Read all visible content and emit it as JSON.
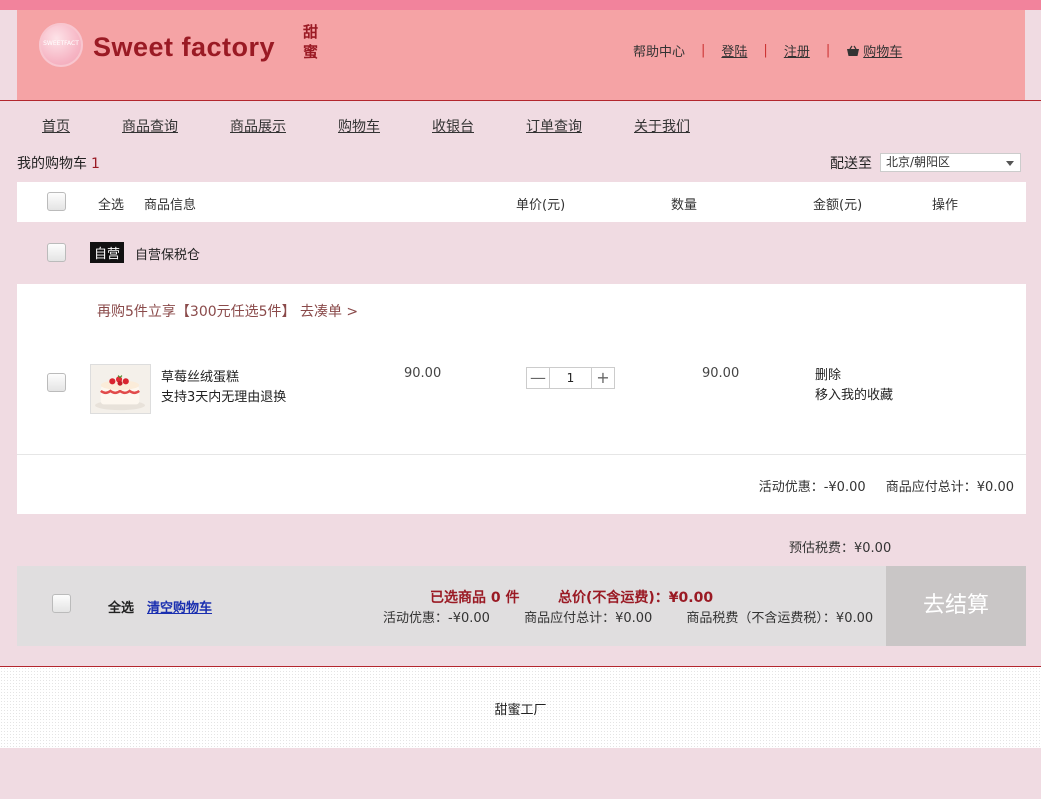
{
  "brand": {
    "name": "Sweet factory",
    "name_cn": "甜蜜",
    "logo_mark": "SWEETFACT"
  },
  "toplinks": {
    "help": "帮助中心",
    "login": "登陆",
    "register": "注册",
    "cart": "购物车",
    "separator": "|"
  },
  "nav": [
    "首页",
    "商品查询",
    "商品展示",
    "购物车",
    "收银台",
    "订单查询",
    "关于我们"
  ],
  "cart": {
    "title": "我的购物车",
    "count": "1"
  },
  "shipping": {
    "label": "配送至",
    "region": "北京/朝阳区"
  },
  "table_headers": {
    "select_all": "全选",
    "product": "商品信息",
    "unit_price": "单价(元)",
    "quantity": "数量",
    "amount": "金额(元)",
    "action": "操作"
  },
  "group": {
    "tag": "自营",
    "name": "自营保税仓"
  },
  "promo": "再购5件立享【300元任选5件】 去凑单 >",
  "item": {
    "name": "草莓丝绒蛋糕",
    "note": "支持3天内无理由退换",
    "price": "90.00",
    "quantity": "1",
    "amount": "90.00",
    "delete": "删除",
    "favorite": "移入我的收藏",
    "minus": "—",
    "plus": "+"
  },
  "subtotal": {
    "discount": "活动优惠：-¥0.00",
    "total": "商品应付总计：¥0.00"
  },
  "tax_estimate": "预估税费：¥0.00",
  "footer_bar": {
    "select_all": "全选",
    "clear": "清空购物车",
    "selected": "已选商品 0 件",
    "total": "总价(不含运费)：¥0.00",
    "discount": "活动优惠：-¥0.00",
    "payable": "商品应付总计：¥0.00",
    "tax": "商品税费（不含运费税）：¥0.00",
    "checkout": "去结算"
  },
  "footer": "甜蜜工厂"
}
